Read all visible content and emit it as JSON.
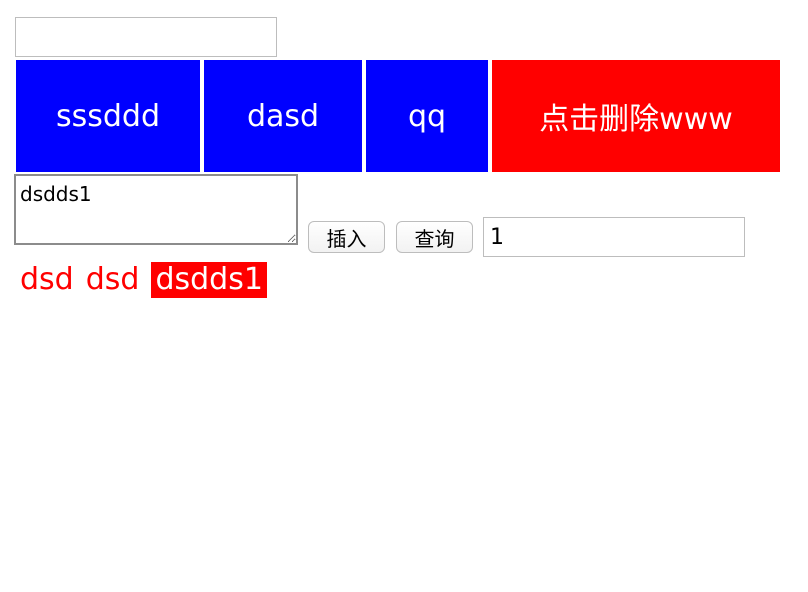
{
  "top_input": {
    "value": "",
    "placeholder": ""
  },
  "tabs": [
    {
      "label": "sssddd",
      "active": false
    },
    {
      "label": "dasd",
      "active": false
    },
    {
      "label": "qq",
      "active": false
    },
    {
      "label": "点击删除www",
      "active": true
    }
  ],
  "editor": {
    "textarea_value": "dsdds1"
  },
  "actions": {
    "insert_label": "插入",
    "query_label": "查询"
  },
  "query_input": {
    "value": "1",
    "placeholder": ""
  },
  "results": [
    {
      "text": "dsd",
      "highlight": false
    },
    {
      "text": "dsd",
      "highlight": false
    },
    {
      "text": "dsdds1",
      "highlight": true
    }
  ],
  "colors": {
    "tab_bg": "#0000ff",
    "active_tab_bg": "#ff0000",
    "result_text": "#ff0000",
    "result_highlight_bg": "#ff0000"
  }
}
